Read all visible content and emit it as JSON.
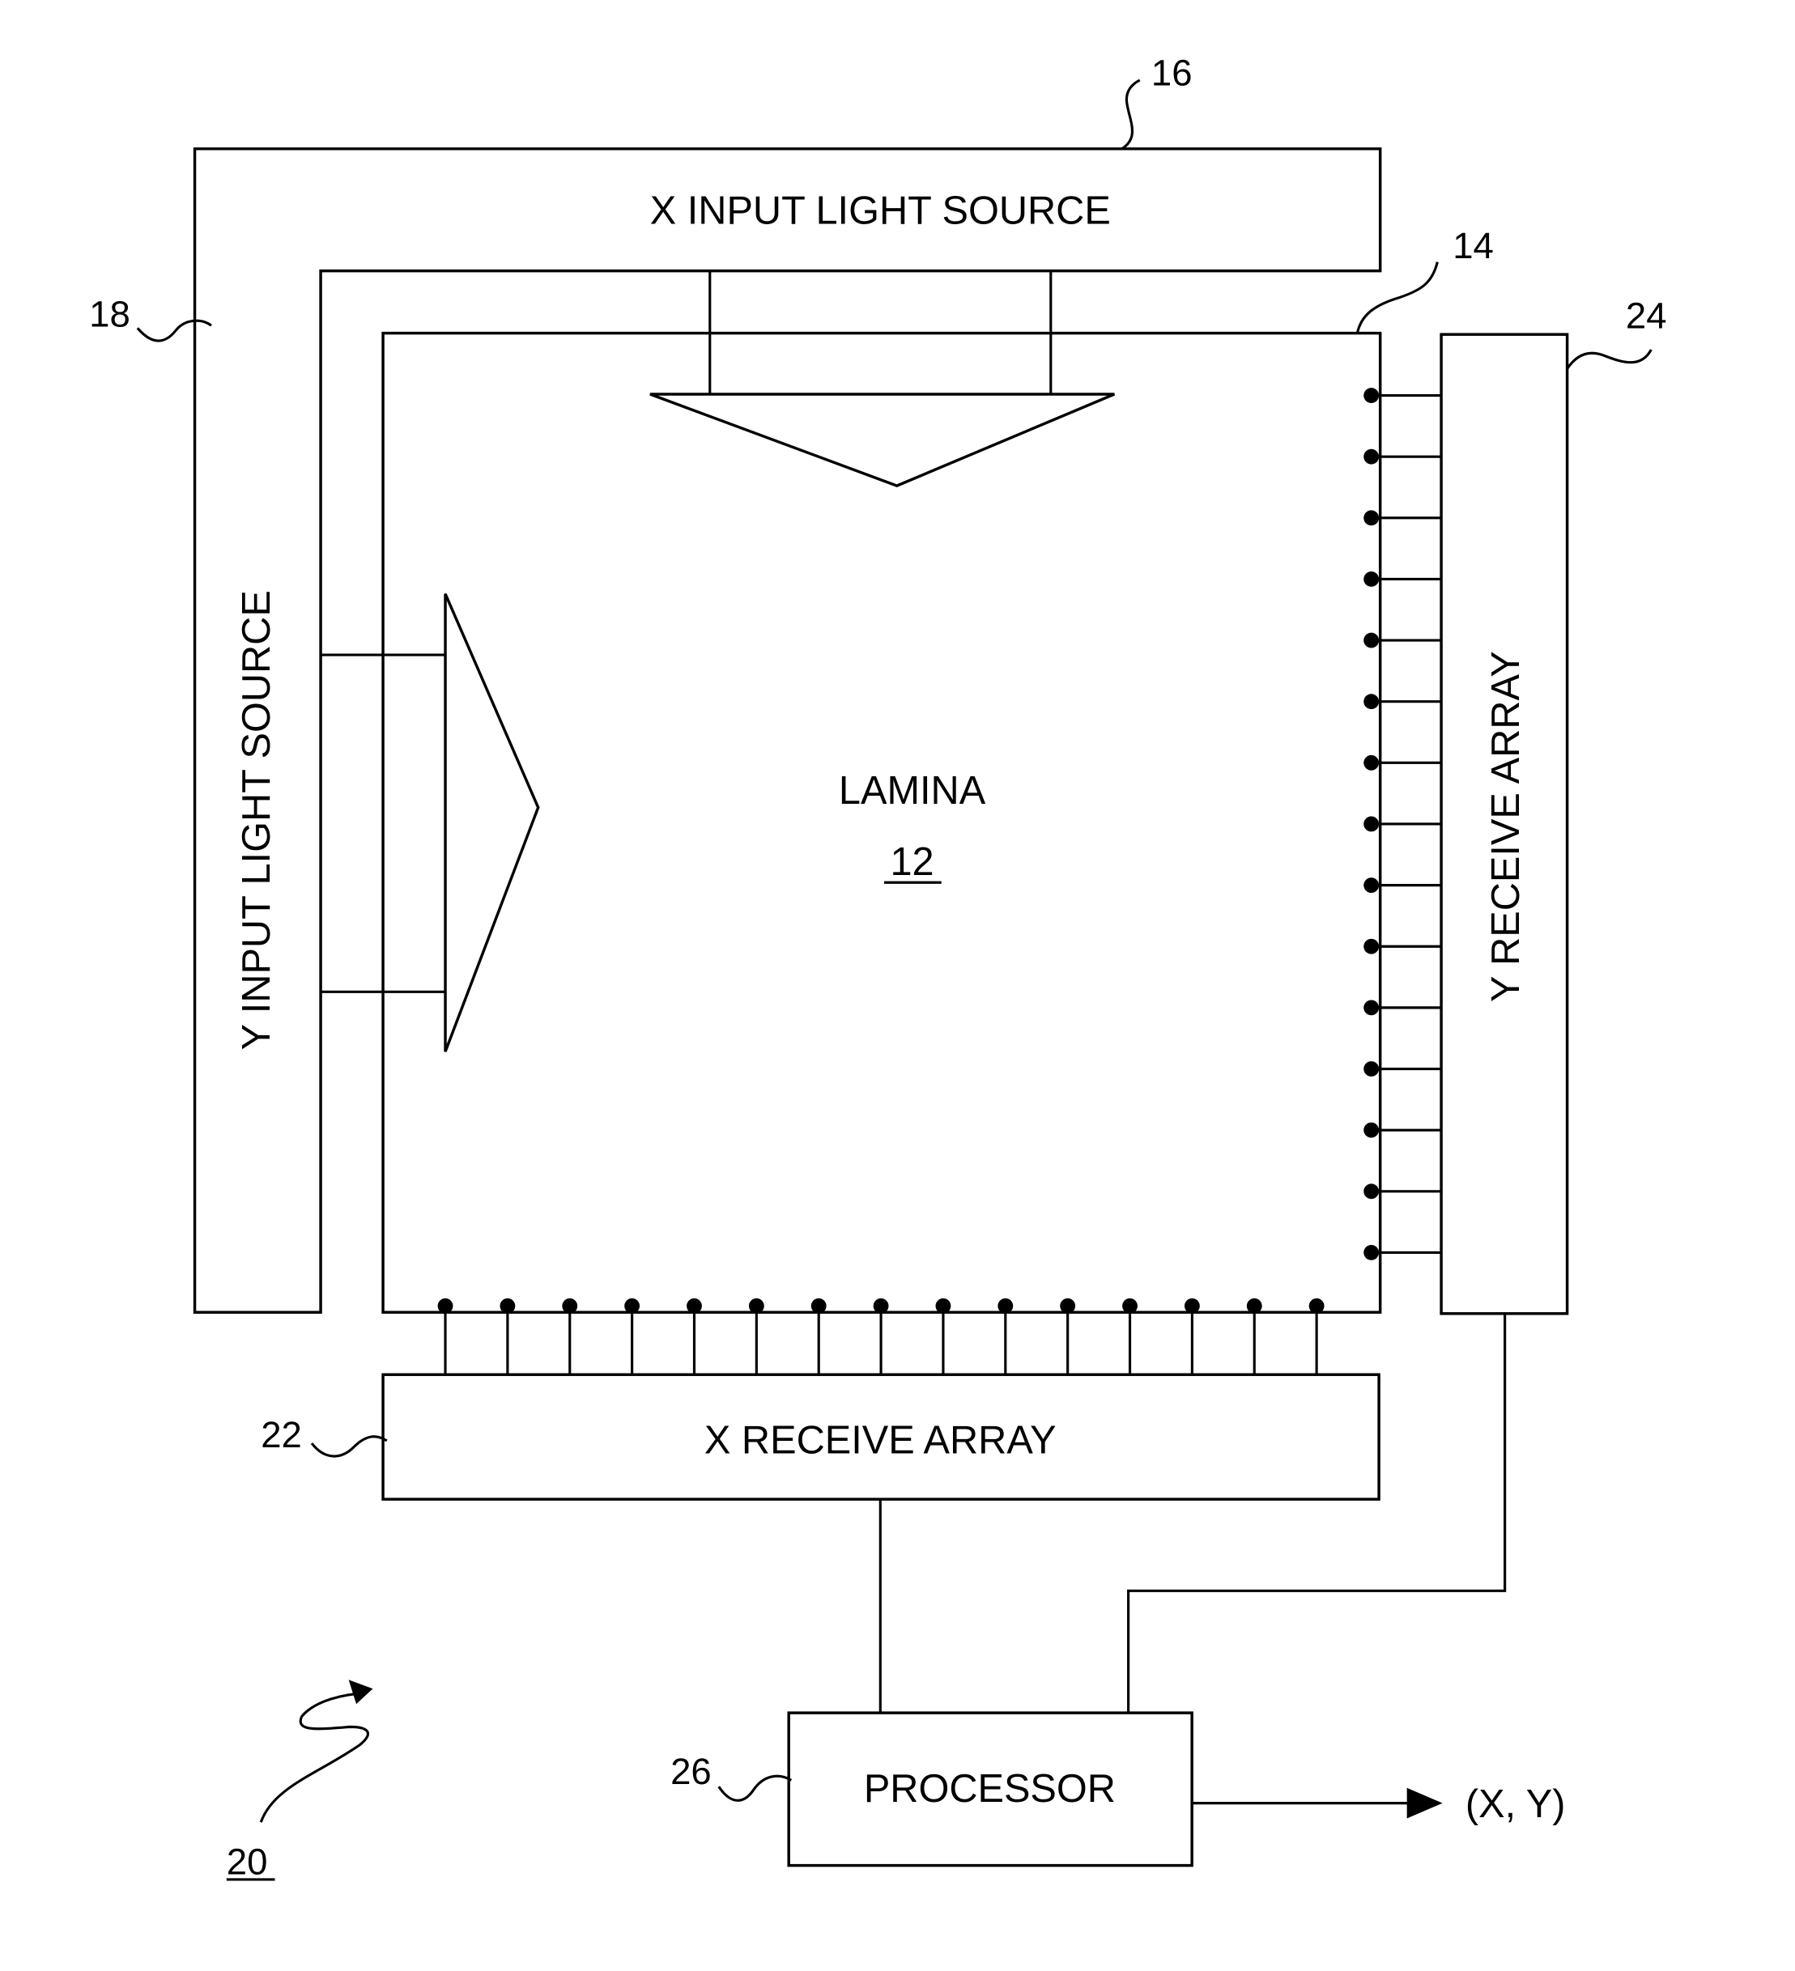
{
  "figure": {
    "ref": "20",
    "arrow_icon": "squiggle-arrow"
  },
  "components": {
    "x_input_light_source": {
      "label": "X INPUT LIGHT SOURCE",
      "ref": "16"
    },
    "y_input_light_source": {
      "label": "Y INPUT LIGHT SOURCE",
      "ref": "18"
    },
    "lamina": {
      "label": "LAMINA",
      "ref": "12",
      "edge_ref": "14"
    },
    "x_receive_array": {
      "label": "X RECEIVE ARRAY",
      "ref": "22",
      "receiver_count": 15
    },
    "y_receive_array": {
      "label": "Y RECEIVE ARRAY",
      "ref": "24",
      "receiver_count": 15
    },
    "processor": {
      "label": "PROCESSOR",
      "ref": "26"
    },
    "output": {
      "label": "(X, Y)"
    }
  }
}
